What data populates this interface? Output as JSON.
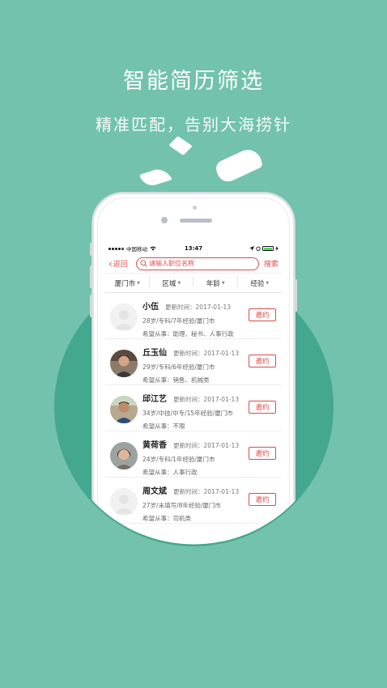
{
  "promo": {
    "headline": "智能简历筛选",
    "subline": "精准匹配，告别大海捞针"
  },
  "status_bar": {
    "carrier": "中国移动",
    "time": "13:47"
  },
  "nav": {
    "back_label": "返回",
    "search_placeholder": "请输入职位名称",
    "search_button": "搜索"
  },
  "filters": [
    {
      "label": "厦门市"
    },
    {
      "label": "区域"
    },
    {
      "label": "年龄"
    },
    {
      "label": "经验"
    }
  ],
  "candidates": [
    {
      "name": "小伍",
      "updated": "更新时间：2017-01-13",
      "summary": "28岁/专科/7年经验/厦门市",
      "desired": "希望从事：助理、秘书、人事行政",
      "action": "邀约",
      "avatar": "placeholder"
    },
    {
      "name": "丘玉仙",
      "updated": "更新时间：2017-01-13",
      "summary": "29岁/专科/6年经验/厦门市",
      "desired": "希望从事：销售、机械类",
      "action": "邀约",
      "avatar": "photo"
    },
    {
      "name": "邱江艺",
      "updated": "更新时间：2017-01-13",
      "summary": "34岁/中技/中专/15年经验/厦门市",
      "desired": "希望从事：不限",
      "action": "邀约",
      "avatar": "photo"
    },
    {
      "name": "黄荷香",
      "updated": "更新时间：2017-01-13",
      "summary": "24岁/专科/1年经验/厦门市",
      "desired": "希望从事：人事行政",
      "action": "邀约",
      "avatar": "photo"
    },
    {
      "name": "周文斌",
      "updated": "更新时间：2017-01-13",
      "summary": "27岁/未填写/8年经验/厦门市",
      "desired": "希望从事：司机类",
      "action": "邀约",
      "avatar": "placeholder"
    }
  ],
  "colors": {
    "background": "#72c2ad",
    "circle": "#43a88d",
    "accent": "#d94c4c"
  }
}
